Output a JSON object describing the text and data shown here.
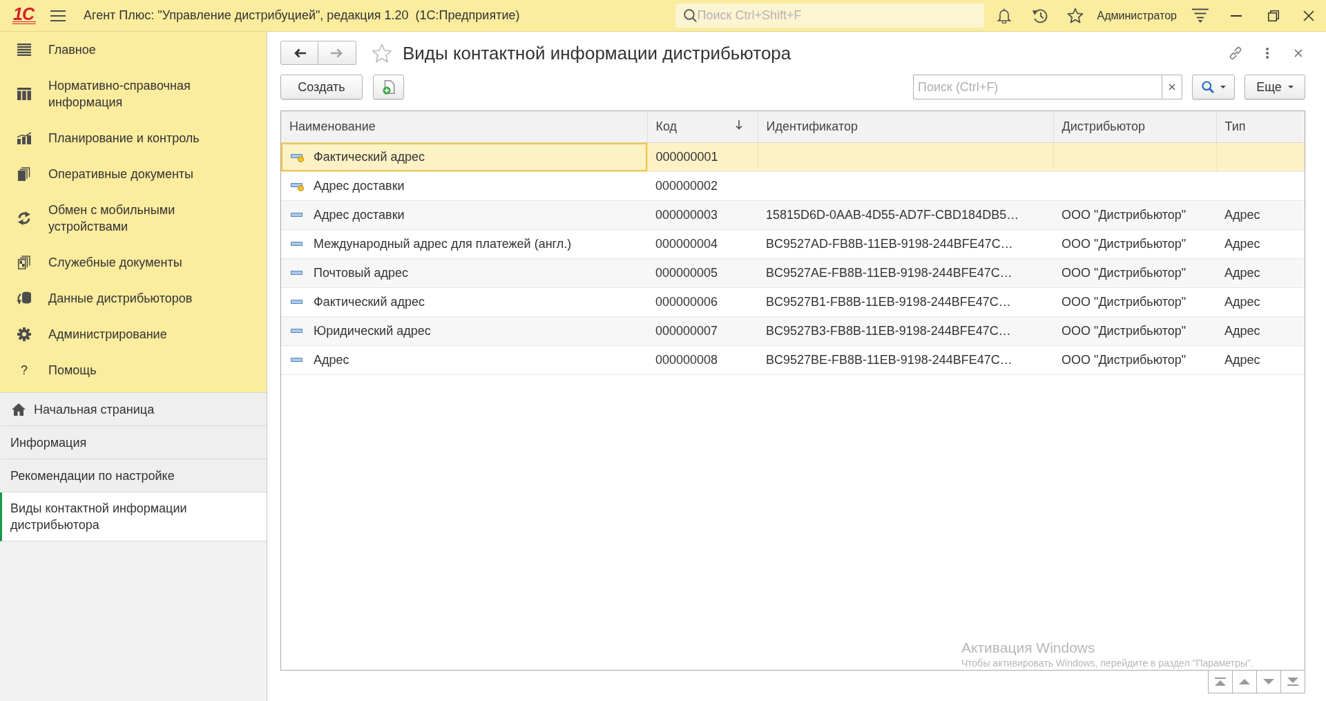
{
  "app_bar": {
    "logo": "1С",
    "title": "Агент Плюс: \"Управление дистрибуцией\", редакция 1.20  (1С:Предприятие)",
    "search": {
      "placeholder": "Поиск Ctrl+Shift+F"
    },
    "user": "Администратор"
  },
  "sections": [
    {
      "label": "Главное"
    },
    {
      "label": "Нормативно-справочная информация"
    },
    {
      "label": "Планирование и контроль"
    },
    {
      "label": "Оперативные документы"
    },
    {
      "label": "Обмен с мобильными устройствами"
    },
    {
      "label": "Служебные документы"
    },
    {
      "label": "Данные дистрибьюторов"
    },
    {
      "label": "Администрирование"
    },
    {
      "label": "Помощь",
      "glyph": "?"
    }
  ],
  "open_windows": [
    {
      "label": "Начальная страница",
      "selected": false
    },
    {
      "label": "Информация",
      "selected": false
    },
    {
      "label": "Рекомендации по настройке",
      "selected": false
    },
    {
      "label": "Виды контактной информации дистрибьютора",
      "selected": true
    }
  ],
  "form": {
    "nav_buttons": [
      {
        "disabled": false
      },
      {
        "disabled": true
      }
    ],
    "favorite": false,
    "title": "Виды контактной информации дистрибьютора",
    "create_button": "Создать",
    "search": {
      "placeholder": "Поиск (Ctrl+F)"
    },
    "more_button": "Еще"
  },
  "table": {
    "columns": [
      {
        "label": "Наименование",
        "sorted": false
      },
      {
        "label": "Код",
        "sorted": true
      },
      {
        "label": "Идентификатор",
        "sorted": false
      },
      {
        "label": "Дистрибьютор",
        "sorted": false
      },
      {
        "label": "Тип",
        "sorted": false
      }
    ],
    "rows": [
      {
        "name": "Фактический адрес",
        "code": "000000001",
        "predefined": true,
        "selected": true
      },
      {
        "name": "Адрес доставки",
        "code": "000000002",
        "predefined": true,
        "selected": false
      },
      {
        "name": "Адрес доставки",
        "code": "000000003",
        "identifier": "15815D6D-0AAB-4D55-AD7F-CBD184DB5…",
        "distributor": "ООО \"Дистрибьютор\"",
        "type": "Адрес",
        "predefined": false,
        "selected": false
      },
      {
        "name": "Международный адрес для платежей (англ.)",
        "code": "000000004",
        "identifier": "BC9527AD-FB8B-11EB-9198-244BFE47C…",
        "distributor": "ООО \"Дистрибьютор\"",
        "type": "Адрес",
        "predefined": false,
        "selected": false
      },
      {
        "name": "Почтовый адрес",
        "code": "000000005",
        "identifier": "BC9527AE-FB8B-11EB-9198-244BFE47C…",
        "distributor": "ООО \"Дистрибьютор\"",
        "type": "Адрес",
        "predefined": false,
        "selected": false
      },
      {
        "name": "Фактический адрес",
        "code": "000000006",
        "identifier": "BC9527B1-FB8B-11EB-9198-244BFE47C…",
        "distributor": "ООО \"Дистрибьютор\"",
        "type": "Адрес",
        "predefined": false,
        "selected": false
      },
      {
        "name": "Юридический адрес",
        "code": "000000007",
        "identifier": "BC9527B3-FB8B-11EB-9198-244BFE47C…",
        "distributor": "ООО \"Дистрибьютор\"",
        "type": "Адрес",
        "predefined": false,
        "selected": false
      },
      {
        "name": "Адрес",
        "code": "000000008",
        "identifier": "BC9527BE-FB8B-11EB-9198-244BFE47C…",
        "distributor": "ООО \"Дистрибьютор\"",
        "type": "Адрес",
        "predefined": false,
        "selected": false
      }
    ]
  },
  "os_watermark": {
    "title": "Активация Windows",
    "text": "Чтобы активировать Windows, перейдите в раздел \"Параметры\"."
  }
}
